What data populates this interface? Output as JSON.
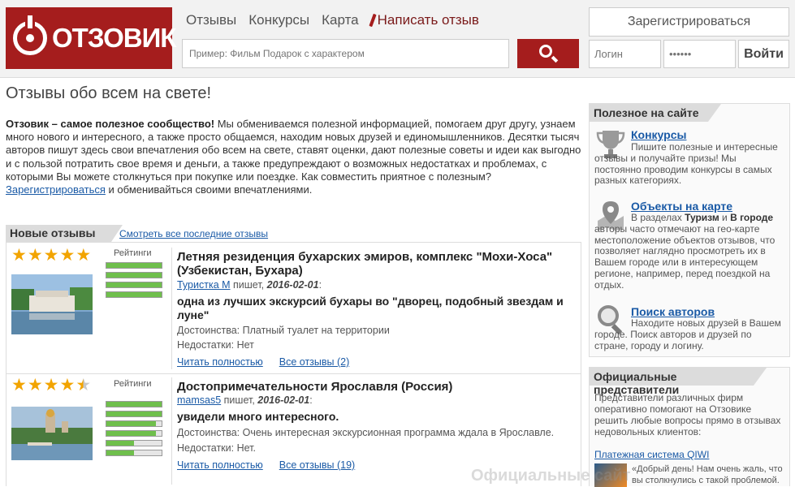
{
  "header": {
    "logo_text": "ОТЗОВИК",
    "nav": [
      "Отзывы",
      "Конкурсы",
      "Карта"
    ],
    "write_review": "Написать отзыв",
    "search_placeholder": "Пример: Фильм Подарок с характером",
    "register": "Зарегистрироваться",
    "login_placeholder": "Логин",
    "password_placeholder": "••••••",
    "login_button": "Войти",
    "brand_color": "#a51d1d"
  },
  "main": {
    "page_title": "Отзывы обо всем на свете!",
    "intro_bold": "Отзовик – самое полезное сообщество!",
    "intro_text": " Мы обмениваемся полезной информацией, помогаем друг другу, узнаем много нового и интересного, а также просто общаемся, находим новых друзей и единомышленников. Десятки тысяч авторов пишут здесь свои впечатления обо всем на свете, ставят оценки, дают полезные советы и идеи как выгодно и с пользой потратить свое время и деньги, а также предупреждают о возможных недостатках и проблемах, с которыми Вы можете столкнуться при покупке или поездке. Как совместить приятное с полезным? ",
    "intro_link": "Зарегистрироваться",
    "intro_end": " и обменивайться своими впечатлениями.",
    "new_reviews_header": "Новые отзывы",
    "see_all_link": "Смотреть все последние отзывы"
  },
  "reviews": [
    {
      "rating_stars": 5,
      "ratings_label": "Рейтинги",
      "rating_bars": [
        1.0,
        1.0,
        1.0,
        1.0
      ],
      "title": "Летняя резиденция бухарских эмиров, комплекс \"Мохи-Хоса\" (Узбекистан, Бухара)",
      "author": "Туристка М",
      "wrote": " пишет, ",
      "date": "2016-02-01",
      "date_suffix": ":",
      "summary": "одна из лучших экскурсий бухары во \"дворец, подобный звездам и луне\"",
      "pros_label": "Достоинства",
      "pros": ": Платный туалет на территории",
      "cons_label": "Недостатки",
      "cons": ": Нет",
      "read_more": "Читать полностью",
      "all_reviews": "Все отзывы (2)"
    },
    {
      "rating_stars": 4.5,
      "ratings_label": "Рейтинги",
      "rating_bars": [
        1.0,
        1.0,
        0.9,
        0.9,
        0.5,
        0.5
      ],
      "title": "Достопримечательности Ярославля (Россия)",
      "author": "mamsas5",
      "wrote": " пишет, ",
      "date": "2016-02-01",
      "date_suffix": ":",
      "summary": "увидели много интересного.",
      "pros_label": "Достоинства",
      "pros": ": Очень интересная экскурсионная программа ждала в Ярославле.",
      "cons_label": "Недостатки",
      "cons": ": Нет.",
      "read_more": "Читать полностью",
      "all_reviews": "Все отзывы (19)"
    }
  ],
  "sidebar": {
    "useful_header": "Полезное на сайте",
    "items": [
      {
        "title": "Конкурсы",
        "icon": "trophy-icon",
        "text": "Пишите полезные и интересные отзывы и получайте призы! Мы постоянно проводим конкурсы в самых разных категориях."
      },
      {
        "title": "Объекты на карте",
        "icon": "map-pin-icon",
        "text_pre": "В разделах ",
        "bold1": "Туризм",
        "text_mid": " и ",
        "bold2": "В городе",
        "text_post": " авторы часто отмечают на гео-карте местоположение объектов отзывов, что позволяет наглядно просмотреть их в Вашем городе или в интересующем регионе, например, перед поездкой на отдых."
      },
      {
        "title": "Поиск авторов",
        "icon": "magnifier-icon",
        "text": "Находите новых друзей в Вашем городе. Поиск авторов и друзей по стране, городу и логину."
      }
    ],
    "reps_header": "Официальные представители",
    "reps_text": "Представители различных фирм оперативно помогают на Отзовике решить любые вопросы прямо в отзывах недовольных клиентов:",
    "reps_link": "Платежная система QIWI",
    "reps_quote": "«Добрый день! Нам очень жаль, что вы столкнулись с такой проблемой."
  },
  "watermark": "Официальные сайт"
}
